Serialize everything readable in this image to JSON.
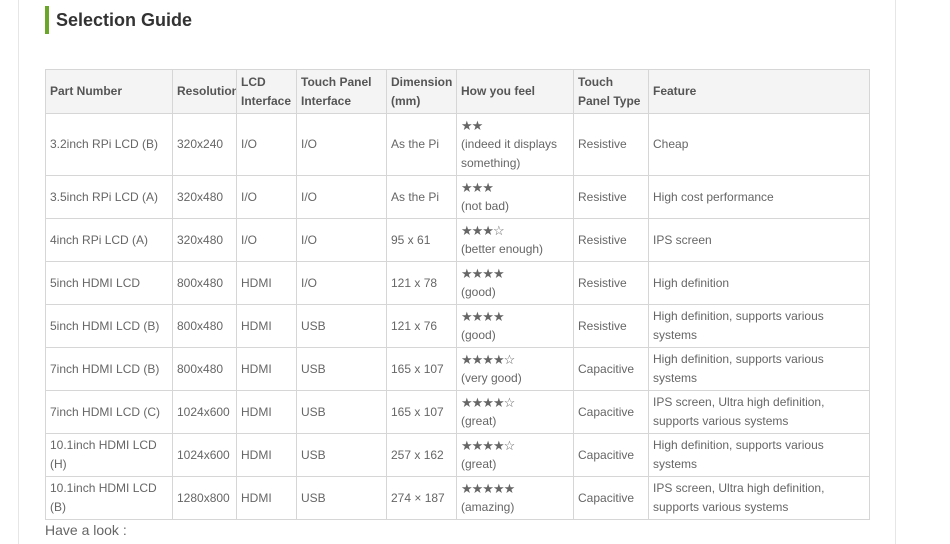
{
  "section": {
    "title": "Selection Guide"
  },
  "table": {
    "headers": [
      "Part Number",
      "Resolution",
      "LCD Interface",
      "Touch Panel Interface",
      "Dimension (mm)",
      "How you feel",
      "Touch Panel Type",
      "Feature"
    ],
    "rows": [
      {
        "part": "3.2inch RPi LCD (B)",
        "resolution": "320x240",
        "lcd_interface": "I/O",
        "touch_interface": "I/O",
        "dimension": "As the Pi",
        "stars": "★★",
        "rating": 2,
        "note": "(indeed it displays something)",
        "panel_type": "Resistive",
        "feature": "Cheap"
      },
      {
        "part": "3.5inch RPi LCD (A)",
        "resolution": "320x480",
        "lcd_interface": "I/O",
        "touch_interface": "I/O",
        "dimension": "As the Pi",
        "stars": "★★★",
        "rating": 3,
        "note": "(not bad)",
        "panel_type": "Resistive",
        "feature": "High cost performance"
      },
      {
        "part": "4inch RPi LCD (A)",
        "resolution": "320x480",
        "lcd_interface": "I/O",
        "touch_interface": "I/O",
        "dimension": "95 x 61",
        "stars": "★★★☆",
        "rating": 3,
        "note": "(better enough)",
        "panel_type": "Resistive",
        "feature": "IPS screen"
      },
      {
        "part": "5inch HDMI LCD",
        "resolution": "800x480",
        "lcd_interface": "HDMI",
        "touch_interface": "I/O",
        "dimension": "121 x 78",
        "stars": "★★★★",
        "rating": 4,
        "note": "(good)",
        "panel_type": "Resistive",
        "feature": "High definition"
      },
      {
        "part": "5inch HDMI LCD (B)",
        "resolution": "800x480",
        "lcd_interface": "HDMI",
        "touch_interface": "USB",
        "dimension": "121 x 76",
        "stars": "★★★★",
        "rating": 4,
        "note": "(good)",
        "panel_type": "Resistive",
        "feature": "High definition, supports various systems"
      },
      {
        "part": "7inch HDMI LCD (B)",
        "resolution": "800x480",
        "lcd_interface": "HDMI",
        "touch_interface": "USB",
        "dimension": "165 x 107",
        "stars": "★★★★☆",
        "rating": 4,
        "note": "(very good)",
        "panel_type": "Capacitive",
        "feature": "High definition, supports various systems"
      },
      {
        "part": "7inch HDMI LCD (C)",
        "resolution": "1024x600",
        "lcd_interface": "HDMI",
        "touch_interface": "USB",
        "dimension": "165 x 107",
        "stars": "★★★★☆",
        "rating": 4,
        "note": "(great)",
        "panel_type": "Capacitive",
        "feature": "IPS screen, Ultra high definition, supports various systems"
      },
      {
        "part": "10.1inch HDMI LCD (H)",
        "resolution": "1024x600",
        "lcd_interface": "HDMI",
        "touch_interface": "USB",
        "dimension": "257 x 162",
        "stars": "★★★★☆",
        "rating": 4,
        "note": "(great)",
        "panel_type": "Capacitive",
        "feature": "High definition, supports various systems"
      },
      {
        "part": "10.1inch HDMI LCD (B)",
        "resolution": "1280x800",
        "lcd_interface": "HDMI",
        "touch_interface": "USB",
        "dimension": "274 × 187",
        "stars": "★★★★★",
        "rating": 5,
        "note": "(amazing)",
        "panel_type": "Capacitive",
        "feature": "IPS screen, Ultra high definition, supports various systems"
      }
    ]
  },
  "footer": {
    "have_look": "Have a look :"
  },
  "colors": {
    "accent": "#6aa728",
    "header_bg": "#f4f4f4",
    "border": "#d6d6d6"
  }
}
